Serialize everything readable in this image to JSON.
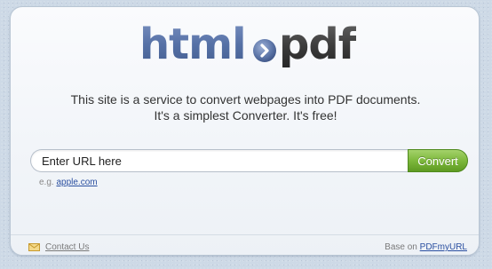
{
  "logo": {
    "part1": "html",
    "arrow_icon": "chevron-right-circle-icon",
    "part2": "pdf"
  },
  "intro": {
    "line1": "This site is a service to convert webpages into PDF documents.",
    "line2": "It's a simplest Converter. It's free!"
  },
  "form": {
    "url_placeholder": "Enter URL here",
    "convert_label": "Convert",
    "example_prefix": "e.g.",
    "example_link": "apple.com"
  },
  "footer": {
    "mail_icon": "envelope-icon",
    "contact_label": "Contact Us",
    "base_prefix": "Base on",
    "base_link": "PDFmyURL"
  },
  "colors": {
    "logo_html": "#5671a6",
    "logo_pdf": "#3a3a3a",
    "convert_button": "#7db83c",
    "link": "#2a4fa0"
  }
}
